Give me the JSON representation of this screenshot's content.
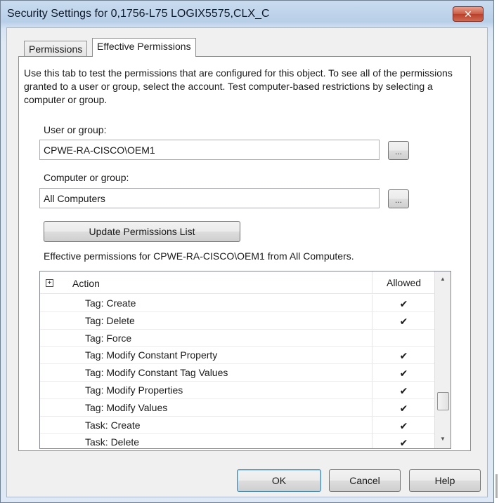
{
  "window": {
    "title": "Security Settings for 0,1756-L75 LOGIX5575,CLX_C",
    "close_label": "✕"
  },
  "tabs": [
    {
      "label": "Permissions"
    },
    {
      "label": "Effective Permissions"
    }
  ],
  "description": "Use this tab to test the permissions that are configured for this object. To see all of the permissions granted to a user or group, select the account. Test computer-based restrictions by selecting a computer or group.",
  "user_group": {
    "label": "User or group:",
    "value": "CPWE-RA-CISCO\\OEM1",
    "browse_label": "..."
  },
  "computer_group": {
    "label": "Computer or group:",
    "value": "All Computers",
    "browse_label": "..."
  },
  "update_button": "Update Permissions List",
  "effective_caption": "Effective permissions for CPWE-RA-CISCO\\OEM1 from All Computers.",
  "list": {
    "expand_glyph": "+",
    "col_action": "Action",
    "col_allowed": "Allowed",
    "rows": [
      {
        "action": "Tag: Create",
        "allowed": "✔"
      },
      {
        "action": "Tag: Delete",
        "allowed": "✔"
      },
      {
        "action": "Tag: Force",
        "allowed": ""
      },
      {
        "action": "Tag: Modify Constant Property",
        "allowed": "✔"
      },
      {
        "action": "Tag: Modify Constant Tag Values",
        "allowed": "✔"
      },
      {
        "action": "Tag: Modify Properties",
        "allowed": "✔"
      },
      {
        "action": "Tag: Modify Values",
        "allowed": "✔"
      },
      {
        "action": "Task: Create",
        "allowed": "✔"
      },
      {
        "action": "Task: Delete",
        "allowed": "✔"
      }
    ]
  },
  "buttons": {
    "ok": "OK",
    "cancel": "Cancel",
    "help": "Help"
  },
  "colors": {
    "title_bar": "#b8cfe8",
    "close_button": "#c85a44",
    "dialog_face": "#f0f0f0"
  }
}
